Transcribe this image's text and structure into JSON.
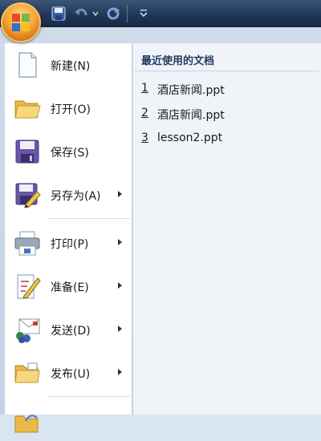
{
  "window": {
    "quick_access": [
      {
        "name": "save-icon"
      },
      {
        "name": "undo-icon"
      },
      {
        "name": "redo-icon"
      },
      {
        "name": "customize-icon"
      }
    ]
  },
  "menu": {
    "items": [
      {
        "label": "新建(N)",
        "icon": "new-document-icon",
        "submenu": false
      },
      {
        "label": "打开(O)",
        "icon": "open-folder-icon",
        "submenu": false
      },
      {
        "label": "保存(S)",
        "icon": "save-disk-icon",
        "submenu": false
      },
      {
        "label": "另存为(A)",
        "icon": "save-as-icon",
        "submenu": true
      },
      {
        "label": "打印(P)",
        "icon": "printer-icon",
        "submenu": true
      },
      {
        "label": "准备(E)",
        "icon": "prepare-icon",
        "submenu": true
      },
      {
        "label": "发送(D)",
        "icon": "send-icon",
        "submenu": true
      },
      {
        "label": "发布(U)",
        "icon": "publish-icon",
        "submenu": true
      }
    ]
  },
  "recent": {
    "title": "最近使用的文档",
    "items": [
      {
        "num": "1",
        "name": "酒店新闻.ppt"
      },
      {
        "num": "2",
        "name": "酒店新闻.ppt"
      },
      {
        "num": "3",
        "name": "lesson2.ppt"
      }
    ]
  },
  "colors": {
    "title_bar": "#1f3552",
    "menu_bg": "#ffffff",
    "recent_bg": "#f0f4f9",
    "orb": "#f7a135"
  }
}
